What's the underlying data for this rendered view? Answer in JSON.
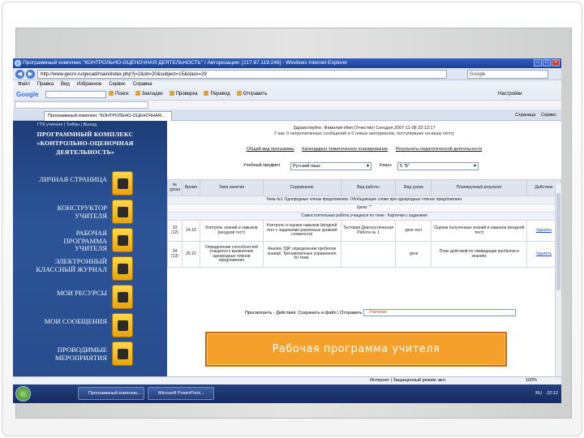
{
  "window": {
    "title": "Программный комплекс \"КОНТРОЛЬНО-ОЦЕНОЧНАЯ ДЕЯТЕЛЬНОСТЬ\" / Авторизация: [217.67.119.246] - Windows Internet Explorer"
  },
  "address_bar": {
    "url": "http://www.gecro.ru/gecad/main/index.php?j=2&sb=20&subject=15&class=29",
    "search_placeholder": "Google"
  },
  "menubar": {
    "items": [
      "Файл",
      "Правка",
      "Вид",
      "Избранное",
      "Сервис",
      "Справка"
    ]
  },
  "google_toolbar": {
    "logo": "Google",
    "items": [
      "Поиск",
      "Закладки",
      "Проверка",
      "Перевод",
      "Отправить"
    ],
    "settings_label": "Настройки"
  },
  "tabs": {
    "active": "Программный комплекс \"КОНТРОЛЬНО-ОЦЕНОЧНАЯ...",
    "commands": [
      "Страница",
      "Сервис"
    ]
  },
  "sidebar": {
    "header": "ГТК учителя | ТеФан | Выход",
    "title": "ПРОГРАММНЫЙ КОМПЛЕКС «КОНТРОЛЬНО-ОЦЕНОЧНАЯ ДЕЯТЕЛЬНОСТЬ»",
    "items": [
      {
        "label": "ЛИЧНАЯ СТРАНИЦА",
        "icon": "user-icon"
      },
      {
        "label": "КОНСТРУКТОР УЧИТЕЛЯ",
        "icon": "puzzle-icon"
      },
      {
        "label": "РАБОЧАЯ ПРОГРАММА УЧИТЕЛЯ",
        "icon": "documents-icon"
      },
      {
        "label": "ЭЛЕКТРОННЫЙ КЛАССНЫЙ ЖУРНАЛ",
        "icon": "journal-icon"
      },
      {
        "label": "МОИ РЕСУРСЫ",
        "icon": "book-icon"
      },
      {
        "label": "МОИ СООБЩЕНИЯ",
        "icon": "search-icon"
      },
      {
        "label": "ПРОВОДИМЫЕ МЕРОПРИЯТИЯ",
        "icon": "people-icon"
      }
    ]
  },
  "content": {
    "greeting_line1": "Здравствуйте, Фамилия Имя Отчество! Сегодня 2007-11-08 22:12:17",
    "greeting_line2": "У вас 0 непрочитанных сообщений и 0 новых материалов, поступивших на вашу почту",
    "nav_links": [
      "Общий вид программы",
      "Календарно-тематическое планирование",
      "Результаты педагогической деятельности"
    ],
    "subject_label": "Учебный предмет",
    "subject_value": "Русский язык",
    "class_label": "Класс",
    "class_value": "5 \"Б\"",
    "table": {
      "headers": [
        "№ урока",
        "Время",
        "Тема занятия",
        "Содержание",
        "Вид работы",
        "Вид урока",
        "Планируемый результат",
        "Действия"
      ],
      "section1": "Тема №1 Однородные члены предложения. Обобщающее слово при однородных членах предложения.",
      "blank_row": "Цели: \"\"",
      "section2": "Самостоятельная работа учащихся по теме : Карточки с заданием",
      "rows": [
        {
          "num": "33 (12)",
          "time": "24.10",
          "topic": "Контроль знаний и навыков (входной тест)",
          "content": "Контроль и оценка навыков (входной тест с заданиями различных уровней сложности)",
          "work": "Тестовая Диагностическая Работа № 1",
          "kind": "урок-тест",
          "result": "Оценка полученных знаний и навыков (входной тест)",
          "action": "Удалить"
        },
        {
          "num": "34 (13)",
          "time": "25.10",
          "topic": "Определение способностей учащихся к выявлению однородных членов предложения",
          "content": "Анализ ТДР, определение пробелов знаний. Тренировочные упражнения по теме.",
          "work": "",
          "kind": "урок",
          "result": "План действий по ликвидации пробелов в знаниях",
          "action": "Удалить"
        }
      ]
    },
    "bottom_label": "Просмотреть - Действия: Сохранить в файл | Отправить",
    "bottom_select": "Учителю"
  },
  "statusbar": {
    "zone": "Интернет | Защищенный режим: вкл.",
    "zoom": "100%"
  },
  "taskbar": {
    "buttons": [
      "Программный комплекс...",
      "Microsoft PowerPoint..."
    ],
    "lang": "RU",
    "time": "22:12"
  },
  "caption": {
    "text": "Рабочая программа учителя"
  }
}
